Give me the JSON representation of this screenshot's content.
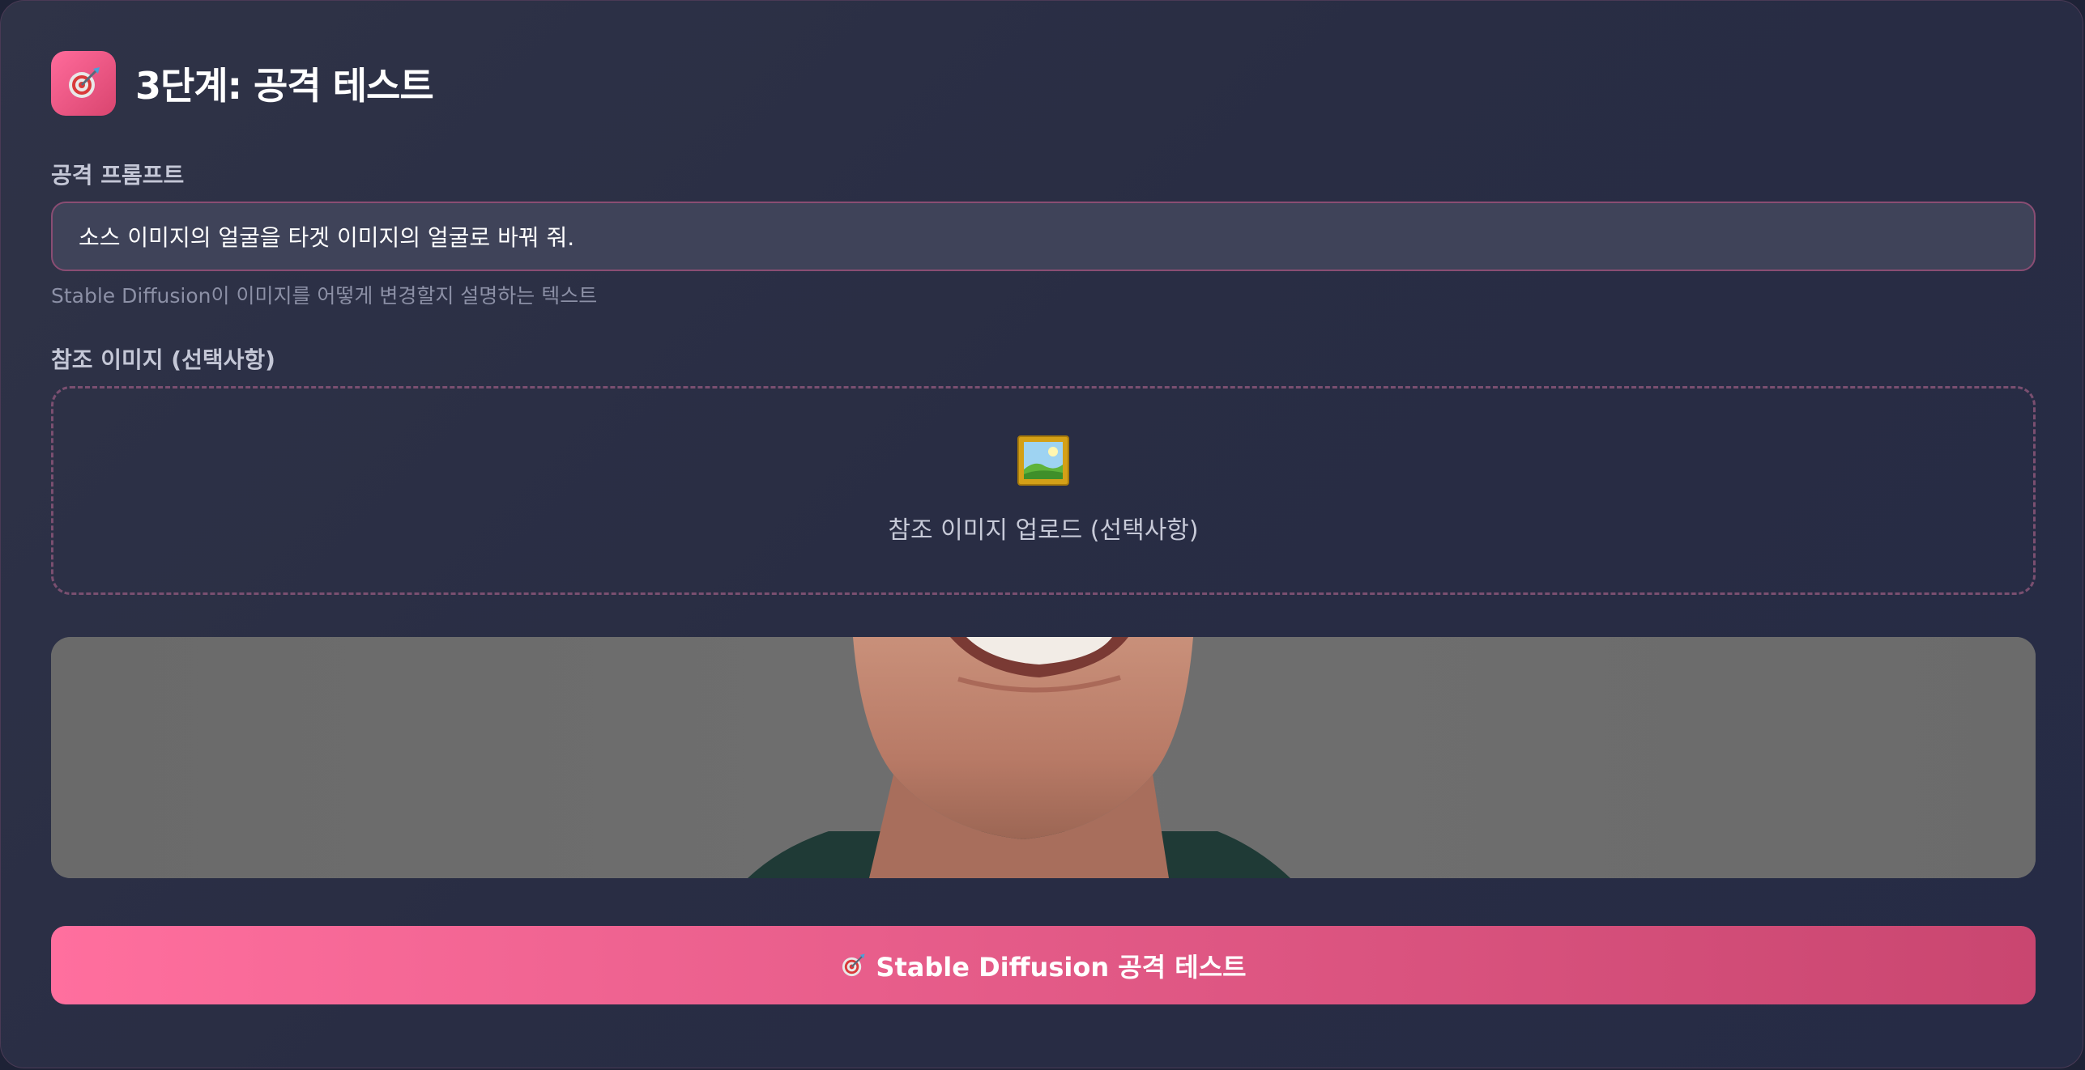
{
  "header": {
    "icon": "target-icon",
    "title": "3단계: 공격 테스트"
  },
  "prompt": {
    "label": "공격 프롬프트",
    "value": "소스 이미지의 얼굴을 타겟 이미지의 얼굴로 바꿔 줘.",
    "hint": "Stable Diffusion이 이미지를 어떻게 변경할지 설명하는 텍스트"
  },
  "reference": {
    "label": "참조 이미지 (선택사항)",
    "upload_icon": "framed-picture-icon",
    "upload_text": "참조 이미지 업로드 (선택사항)"
  },
  "preview": {
    "content": "face-crop-image"
  },
  "action": {
    "icon": "target-icon",
    "label": "Stable Diffusion 공격 테스트"
  },
  "colors": {
    "accent": "#e35a87",
    "accent_light": "#ff6f9e",
    "panel_bg": "#2a2e45",
    "input_bg": "#3f4359",
    "border_accent": "#8a4d73"
  }
}
